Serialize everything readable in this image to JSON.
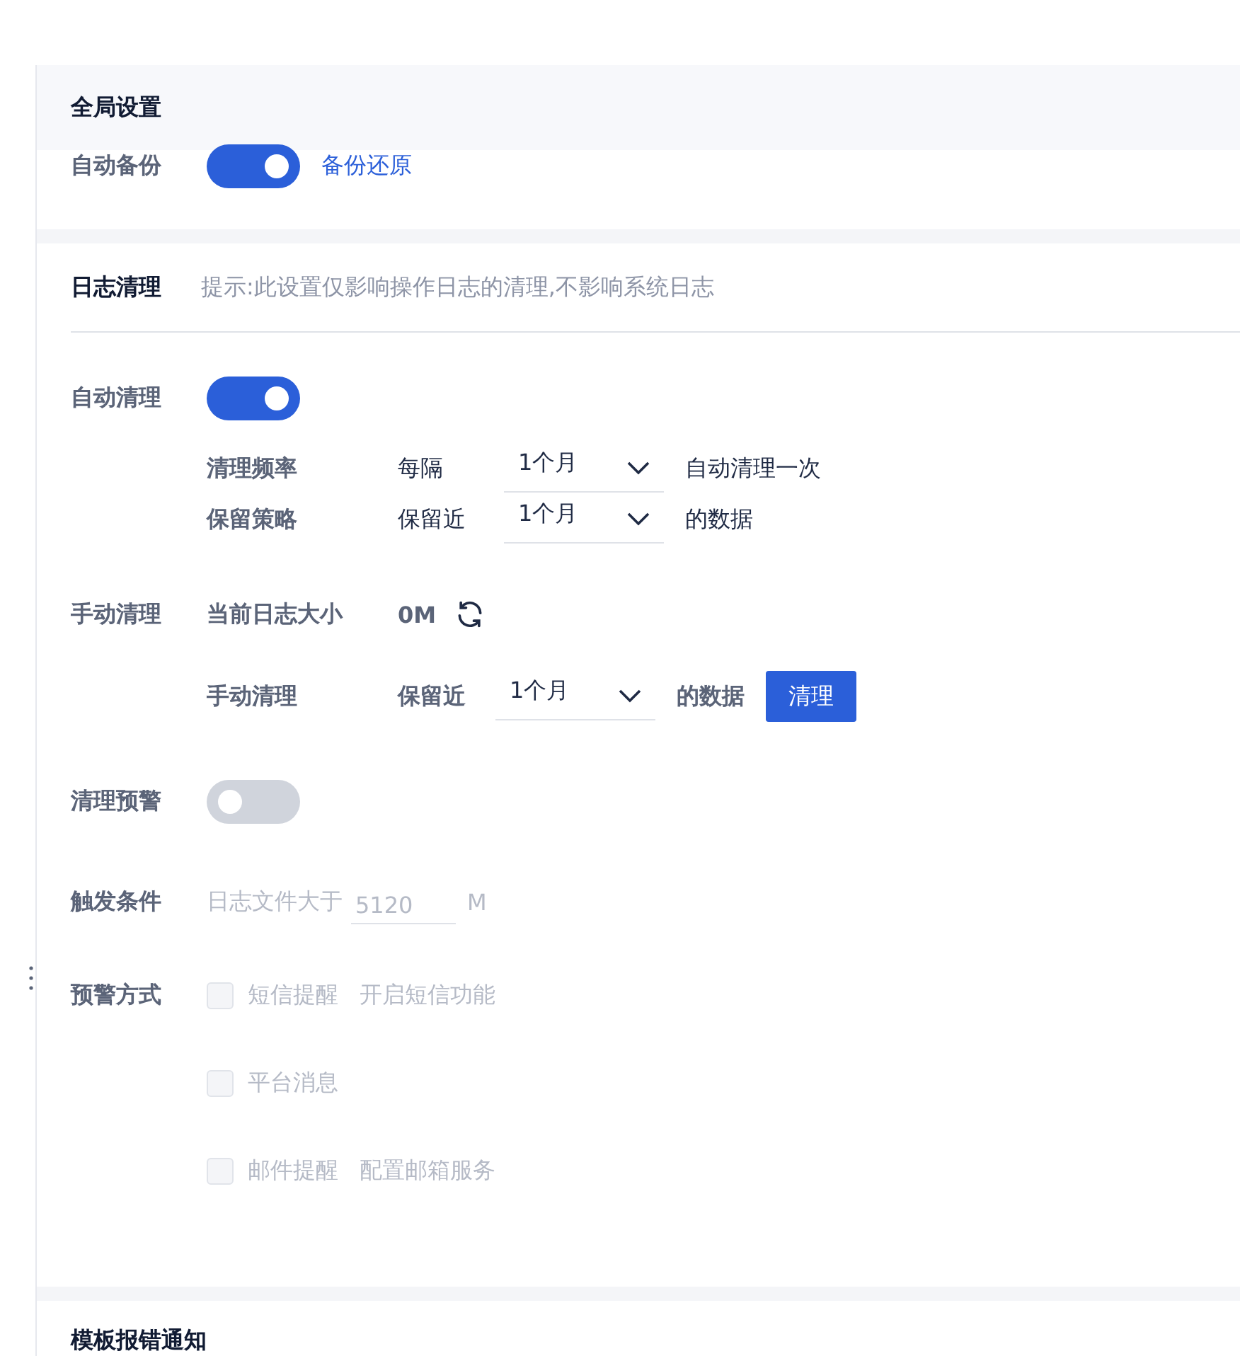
{
  "global": {
    "title": "全局设置",
    "auto_backup": {
      "label": "自动备份",
      "on": true,
      "link": "备份还原"
    }
  },
  "log_cleanup": {
    "title": "日志清理",
    "hint": "提示:此设置仅影响操作日志的清理,不影响系统日志",
    "auto": {
      "label": "自动清理",
      "on": true,
      "rows": [
        {
          "label": "清理频率",
          "prefix": "每隔",
          "select": "1个月",
          "suffix": "自动清理一次"
        },
        {
          "label": "保留策略",
          "prefix": "保留近",
          "select": "1个月",
          "suffix": "的数据"
        }
      ]
    },
    "manual": {
      "label": "手动清理",
      "size_label": "当前日志大小",
      "size": "0M",
      "row": {
        "label": "手动清理",
        "prefix": "保留近",
        "select": "1个月",
        "suffix": "的数据",
        "button": "清理"
      }
    },
    "warning": {
      "label": "清理预警",
      "on": false
    },
    "trigger": {
      "label": "触发条件",
      "prefix": "日志文件大于",
      "value": "5120",
      "unit": "M"
    },
    "methods": {
      "label": "预警方式",
      "options": [
        {
          "label": "短信提醒",
          "link": "开启短信功能",
          "checked": false
        },
        {
          "label": "平台消息",
          "checked": false
        },
        {
          "label": "邮件提醒",
          "link": "配置邮箱服务",
          "checked": false
        }
      ]
    }
  },
  "template_error": {
    "title": "模板报错通知"
  }
}
